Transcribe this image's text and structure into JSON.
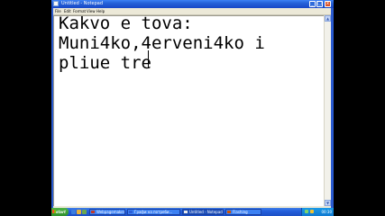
{
  "window": {
    "title": "Untitled - Notepad",
    "minimize_label": "_",
    "maximize_label": "□",
    "close_label": "x"
  },
  "menu": [
    {
      "label": "File"
    },
    {
      "label": "Edit"
    },
    {
      "label": "Format"
    },
    {
      "label": "View"
    },
    {
      "label": "Help"
    }
  ],
  "document": {
    "lines": [
      "Kakvo e tova:",
      "Muni4ko,4erveni4ko i",
      "pliue tre"
    ]
  },
  "scrollbar": {
    "up_arrow": "▲",
    "down_arrow": "▼"
  },
  "taskbar": {
    "start_label": "start",
    "tasks": [
      {
        "label": "Webpagemaker",
        "icon": "webpagemaker-icon",
        "color": "#c0392b"
      },
      {
        "label": "Графи на потреби...",
        "icon": "word-document-icon",
        "color": "#2b5fd9"
      },
      {
        "label": "Untitled - Notepad",
        "icon": "notepad-icon",
        "color": "#e8e8e8"
      },
      {
        "label": "Flashing",
        "icon": "flash-icon",
        "color": "#d35400"
      }
    ],
    "clock": "00:30"
  },
  "colors": {
    "titlebar": "#2561d8",
    "taskbar": "#245edb",
    "start_button": "#2f8f2b",
    "window_frame": "#ece9d8",
    "close_button": "#d9532a"
  }
}
